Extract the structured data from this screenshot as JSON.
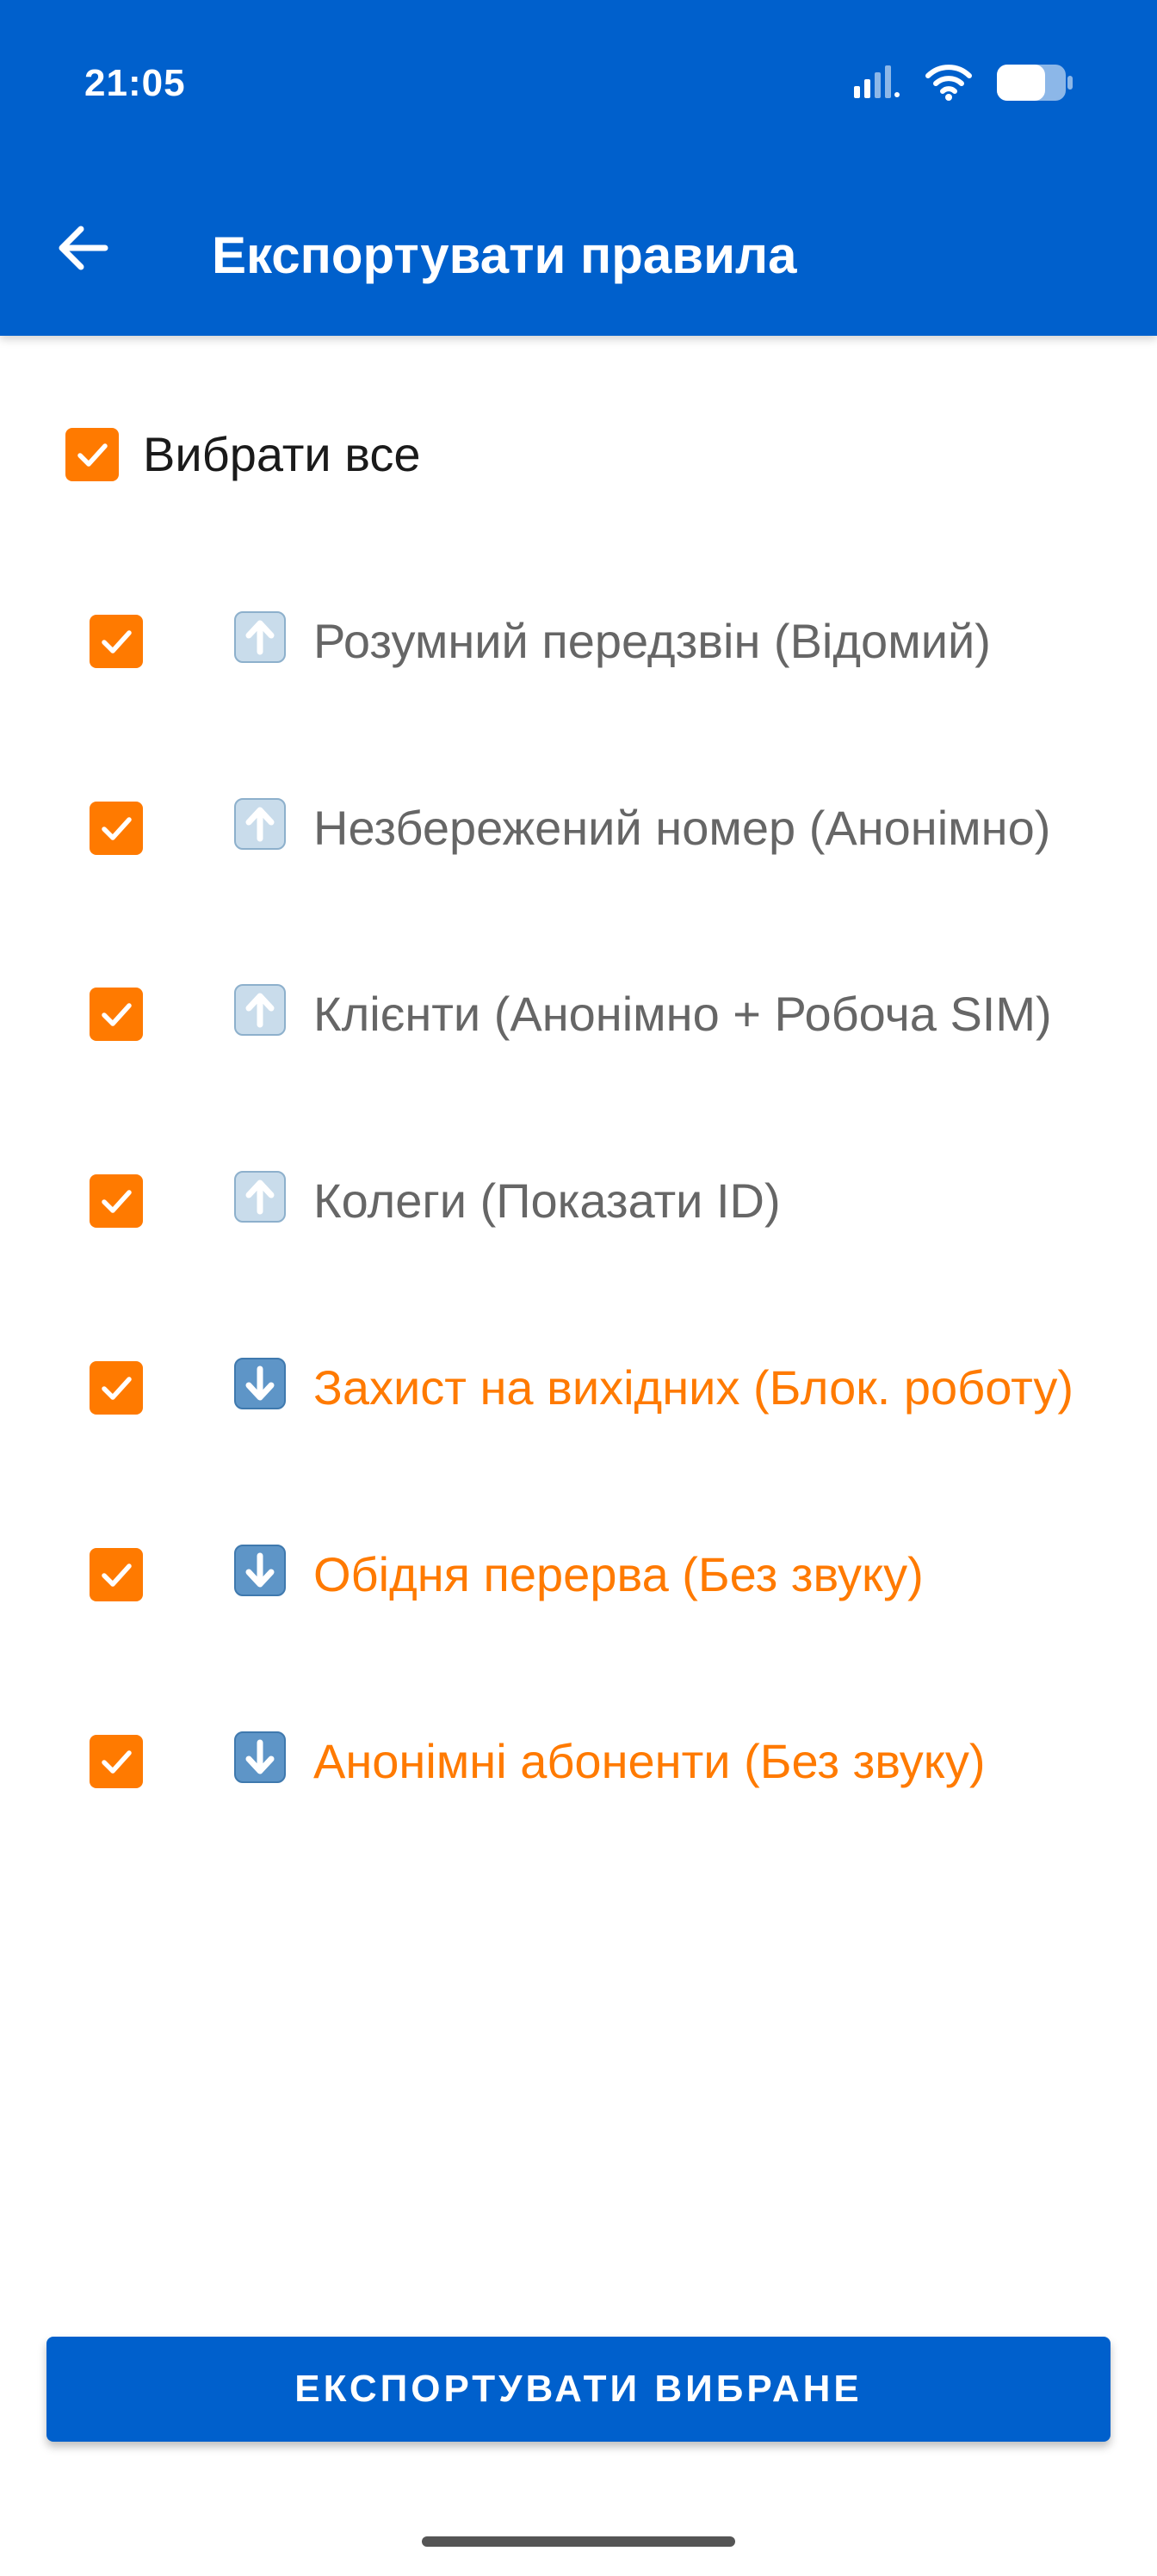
{
  "status_bar": {
    "time": "21:05"
  },
  "header": {
    "title": "Експортувати правила"
  },
  "select_all": {
    "label": "Вибрати все",
    "checked": true
  },
  "rules": [
    {
      "direction": "up",
      "label": "Розумний передзвін (Відомий)",
      "checked": true
    },
    {
      "direction": "up",
      "label": "Незбережений номер (Анонімно)",
      "checked": true
    },
    {
      "direction": "up",
      "label": "Клієнти (Анонімно + Робоча SIM)",
      "checked": true
    },
    {
      "direction": "up",
      "label": "Колеги (Показати ID)",
      "checked": true
    },
    {
      "direction": "down",
      "label": "Захист на вихідних (Блок. роботу)",
      "checked": true
    },
    {
      "direction": "down",
      "label": "Обідня перерва (Без звуку)",
      "checked": true
    },
    {
      "direction": "down",
      "label": "Анонімні абоненти (Без звуку)",
      "checked": true
    }
  ],
  "export_button": {
    "label": "ЕКСПОРТУВАТИ ВИБРАНЕ"
  },
  "colors": {
    "primary": "#0060CC",
    "accent": "#FF7A00",
    "muted_text": "#666666"
  }
}
